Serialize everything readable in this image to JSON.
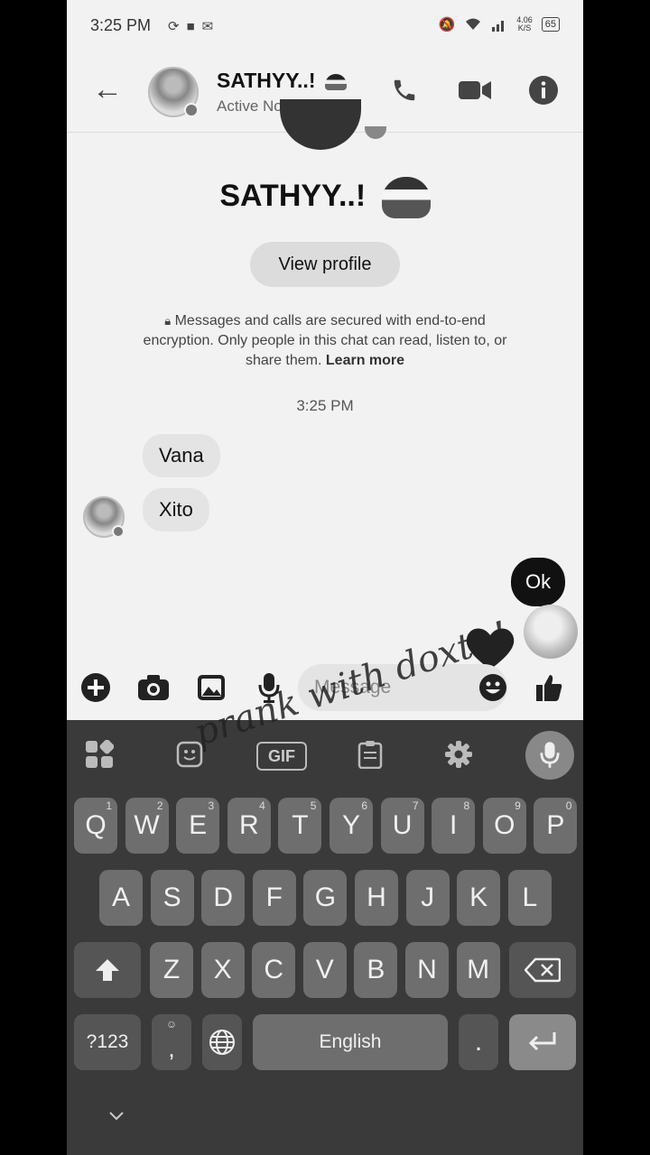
{
  "status_bar": {
    "time": "3:25 PM",
    "speed_top": "4.06",
    "speed_unit": "K/S",
    "battery": "65"
  },
  "header": {
    "name": "SATHYY..!",
    "status": "Active Now",
    "icons": [
      "back-arrow-icon",
      "phone-icon",
      "video-camera-icon",
      "info-icon"
    ]
  },
  "profile": {
    "name": "SATHYY..!",
    "view_profile": "View profile"
  },
  "encryption": {
    "text": "Messages and calls are secured with end-to-end encryption. Only people in this chat can read, listen to, or share them.",
    "learn_more": "Learn more"
  },
  "chat": {
    "timestamp": "3:25 PM",
    "incoming": [
      "Vana",
      "Xito"
    ],
    "outgoing": [
      "Ok"
    ]
  },
  "composer": {
    "placeholder": "Message"
  },
  "keyboard": {
    "row1": [
      {
        "k": "Q",
        "h": "1"
      },
      {
        "k": "W",
        "h": "2"
      },
      {
        "k": "E",
        "h": "3"
      },
      {
        "k": "R",
        "h": "4"
      },
      {
        "k": "T",
        "h": "5"
      },
      {
        "k": "Y",
        "h": "6"
      },
      {
        "k": "U",
        "h": "7"
      },
      {
        "k": "I",
        "h": "8"
      },
      {
        "k": "O",
        "h": "9"
      },
      {
        "k": "P",
        "h": "0"
      }
    ],
    "row2": [
      "A",
      "S",
      "D",
      "F",
      "G",
      "H",
      "J",
      "K",
      "L"
    ],
    "row3": [
      "Z",
      "X",
      "C",
      "V",
      "B",
      "N",
      "M"
    ],
    "symbols": "?123",
    "comma": ",",
    "space": "English",
    "period": ".",
    "gif": "GIF"
  },
  "watermark": "prank with doxt..!"
}
